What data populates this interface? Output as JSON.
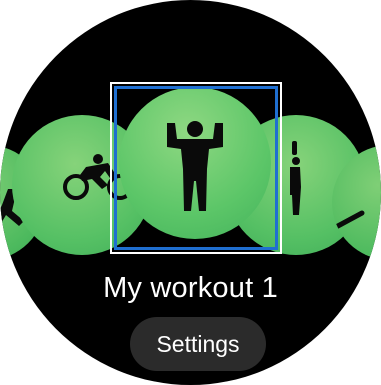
{
  "screen": {
    "background_color": "#000000",
    "accent_color": "#5cc668",
    "focus_color": "#1f6fd1"
  },
  "carousel": {
    "items": [
      {
        "icon": "running-icon"
      },
      {
        "icon": "cycling-icon"
      },
      {
        "icon": "custom-workout-icon",
        "selected": true
      },
      {
        "icon": "stretching-icon"
      },
      {
        "icon": "sport-icon"
      }
    ]
  },
  "workout": {
    "title": "My workout 1"
  },
  "settings": {
    "label": "Settings"
  }
}
